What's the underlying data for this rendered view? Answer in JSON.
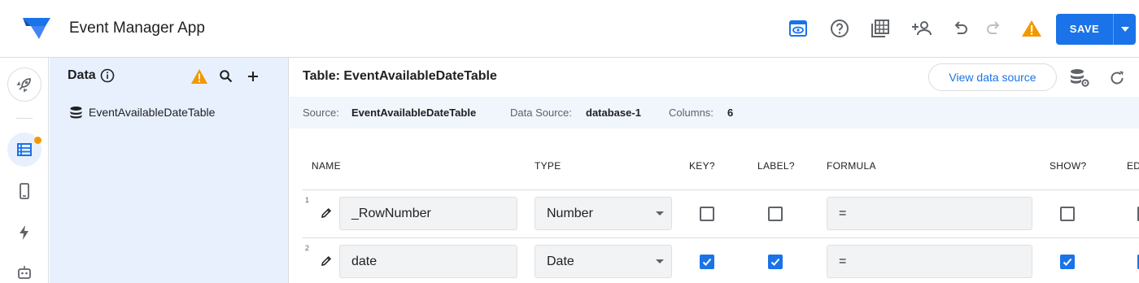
{
  "app": {
    "title": "Event Manager App",
    "save_label": "SAVE"
  },
  "data_panel": {
    "title": "Data",
    "tables": [
      {
        "label": "EventAvailableDateTable"
      }
    ]
  },
  "main": {
    "title": "Table: EventAvailableDateTable",
    "view_source_label": "View data source",
    "info": {
      "source_label": "Source:",
      "source_value": "EventAvailableDateTable",
      "datasource_label": "Data Source:",
      "datasource_value": "database-1",
      "columns_label": "Columns:",
      "columns_value": "6"
    }
  },
  "columns_table": {
    "headers": {
      "name": "NAME",
      "type": "TYPE",
      "key": "KEY?",
      "label": "LABEL?",
      "formula": "FORMULA",
      "show": "SHOW?",
      "editable": "ED"
    },
    "rows": [
      {
        "num": "1",
        "name": "_RowNumber",
        "type": "Number",
        "key": false,
        "label": false,
        "formula": "=",
        "show": false,
        "editable": false
      },
      {
        "num": "2",
        "name": "date",
        "type": "Date",
        "key": true,
        "label": true,
        "formula": "=",
        "show": true,
        "editable": true
      }
    ]
  },
  "colors": {
    "accent": "#1a73e8",
    "warning": "#f29900",
    "panel_bg": "#e8f0fe"
  },
  "icons": {
    "toolbar": [
      "preview-icon",
      "help-icon",
      "gallery-icon",
      "add-user-icon",
      "undo-icon",
      "redo-icon",
      "warning-icon"
    ],
    "rail": [
      "launch-icon",
      "data-icon",
      "views-icon",
      "automation-icon",
      "bot-icon"
    ]
  }
}
